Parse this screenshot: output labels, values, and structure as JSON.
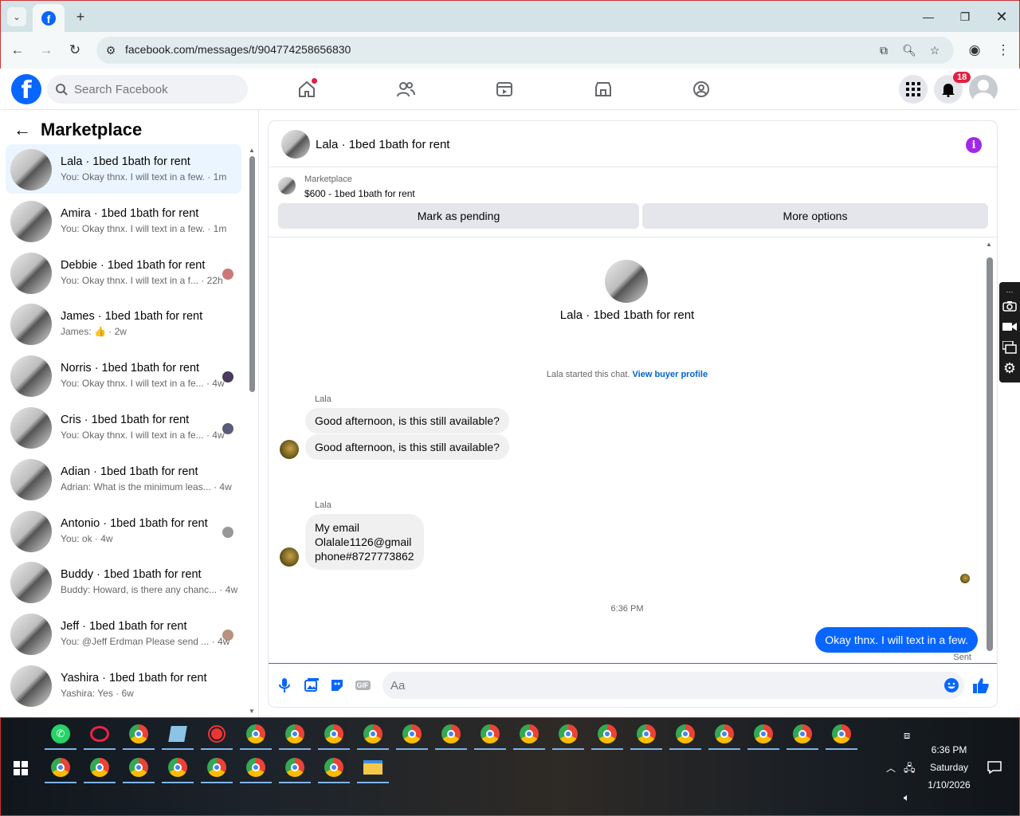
{
  "browser": {
    "url": "facebook.com/messages/t/904774258656830"
  },
  "fb": {
    "search_placeholder": "Search Facebook",
    "notif_count": "18"
  },
  "sidebar": {
    "title": "Marketplace",
    "conversations": [
      {
        "name": "Lala · 1bed 1bath for rent",
        "preview": "You: Okay thnx. I will text in a few. · 1m",
        "active": true
      },
      {
        "name": "Amira · 1bed 1bath for rent",
        "preview": "You: Okay thnx. I will text in a few. · 1m"
      },
      {
        "name": "Debbie · 1bed 1bath for rent",
        "preview": "You: Okay thnx. I will text in a f... · 22h"
      },
      {
        "name": "James · 1bed 1bath for rent",
        "preview": "James: 👍 · 2w"
      },
      {
        "name": "Norris · 1bed 1bath for rent",
        "preview": "You: Okay thnx. I will text in a fe... · 4w"
      },
      {
        "name": "Cris · 1bed 1bath for rent",
        "preview": "You: Okay thnx. I will text in a fe... · 4w"
      },
      {
        "name": "Adian · 1bed 1bath for rent",
        "preview": "Adrian: What is the minimum leas... · 4w"
      },
      {
        "name": "Antonio · 1bed 1bath for rent",
        "preview": "You: ok · 4w"
      },
      {
        "name": "Buddy · 1bed 1bath for rent",
        "preview": "Buddy: Howard, is there any chanc... · 4w"
      },
      {
        "name": "Jeff · 1bed 1bath for rent",
        "preview": "You: @Jeff Erdman Please send ... · 4w"
      },
      {
        "name": "Yashira · 1bed 1bath for rent",
        "preview": "Yashira: Yes · 6w"
      }
    ]
  },
  "chat": {
    "title": "Lala · 1bed 1bath for rent",
    "marketplace_label": "Marketplace",
    "listing": "$600 - 1bed 1bath for rent",
    "mark_pending": "Mark as pending",
    "more_options": "More options",
    "profile_name": "Lala · 1bed 1bath for rent",
    "started_text": "Lala started this chat.",
    "view_buyer": "View buyer profile",
    "sender1": "Lala",
    "msg1": "Good afternoon, is this still available?",
    "msg2": "Good afternoon, is this still available?",
    "sender2": "Lala",
    "msg3_line1": "My email",
    "msg3_line2": "Olalale1126@gmail",
    "msg3_line3": "phone#8727773862",
    "timestamp": "6:36 PM",
    "out_msg": "Okay thnx. I will text in a few.",
    "sent_label": "Sent",
    "composer_placeholder": "Aa",
    "gif_label": "GIF"
  },
  "taskbar": {
    "time": "6:36 PM",
    "day": "Saturday",
    "date": "1/10/2026"
  }
}
